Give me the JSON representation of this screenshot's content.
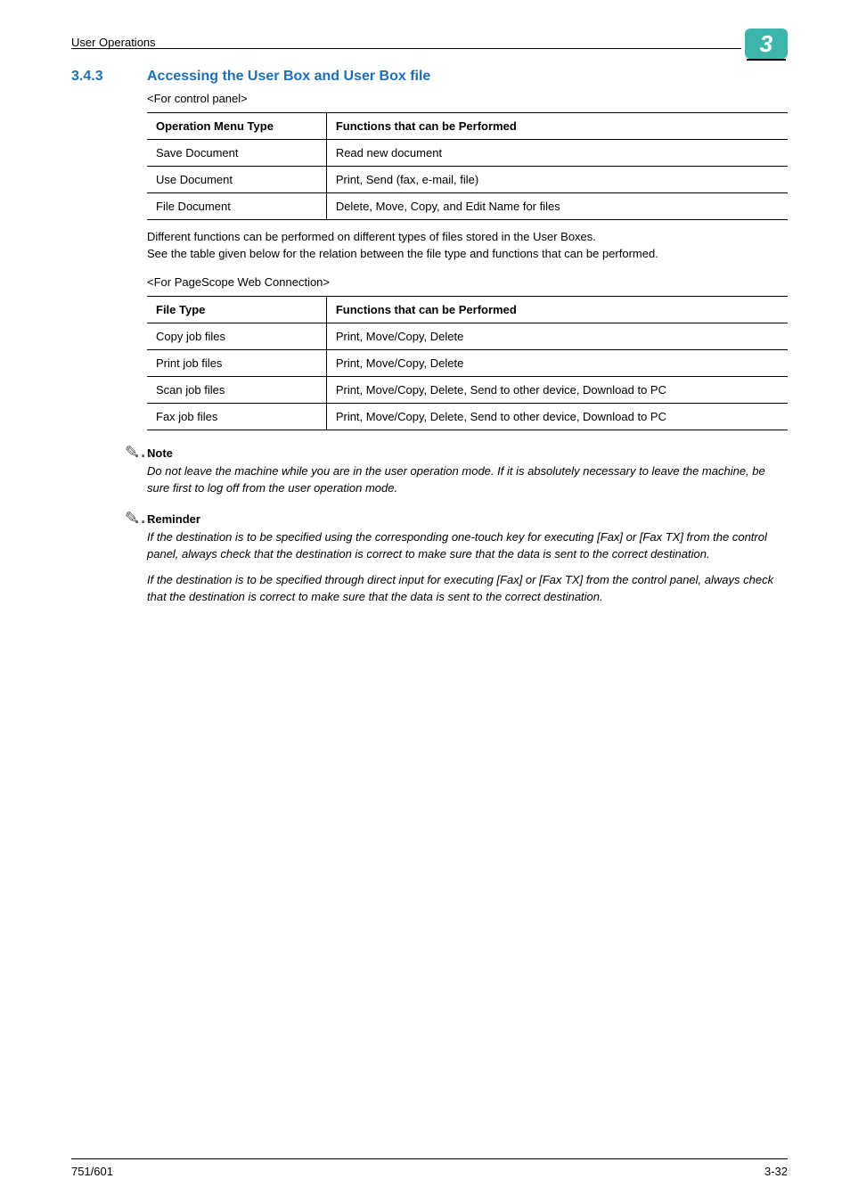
{
  "header": {
    "running": "User Operations",
    "chapter_number": "3"
  },
  "section": {
    "number": "3.4.3",
    "title": "Accessing the User Box and User Box file"
  },
  "block1": {
    "label": "<For control panel>",
    "col1": "Operation Menu Type",
    "col2": "Functions that can be Performed",
    "rows": {
      "r0c0": "Save Document",
      "r0c1": "Read new document",
      "r1c0": "Use Document",
      "r1c1": "Print, Send (fax, e-mail, file)",
      "r2c0": "File Document",
      "r2c1": "Delete, Move, Copy, and Edit Name for files"
    },
    "para": "Different functions can be performed on different types of files stored in the User Boxes.\nSee the table given below for the relation between the file type and functions that can be performed."
  },
  "block2": {
    "label": "<For PageScope Web Connection>",
    "col1": "File Type",
    "col2": "Functions that can be Performed",
    "rows": {
      "r0c0": "Copy job files",
      "r0c1": "Print, Move/Copy, Delete",
      "r1c0": "Print job files",
      "r1c1": "Print, Move/Copy, Delete",
      "r2c0": "Scan job files",
      "r2c1": "Print, Move/Copy, Delete, Send to other device, Download to PC",
      "r3c0": "Fax job files",
      "r3c1": "Print, Move/Copy, Delete, Send to other device, Download to PC"
    }
  },
  "note": {
    "heading": "Note",
    "body": "Do not leave the machine while you are in the user operation mode. If it is absolutely necessary to leave the machine, be sure first to log off from the user operation mode."
  },
  "reminder": {
    "heading": "Reminder",
    "body1": "If the destination is to be specified using the corresponding one-touch key for executing [Fax] or [Fax TX] from the control panel, always check that the destination is correct to make sure that the data is sent to the correct destination.",
    "body2": "If the destination is to be specified through direct input for executing [Fax] or [Fax TX] from the control panel, always check that the destination is correct to make sure that the data is sent to the correct destination."
  },
  "footer": {
    "left": "751/601",
    "right": "3-32"
  }
}
